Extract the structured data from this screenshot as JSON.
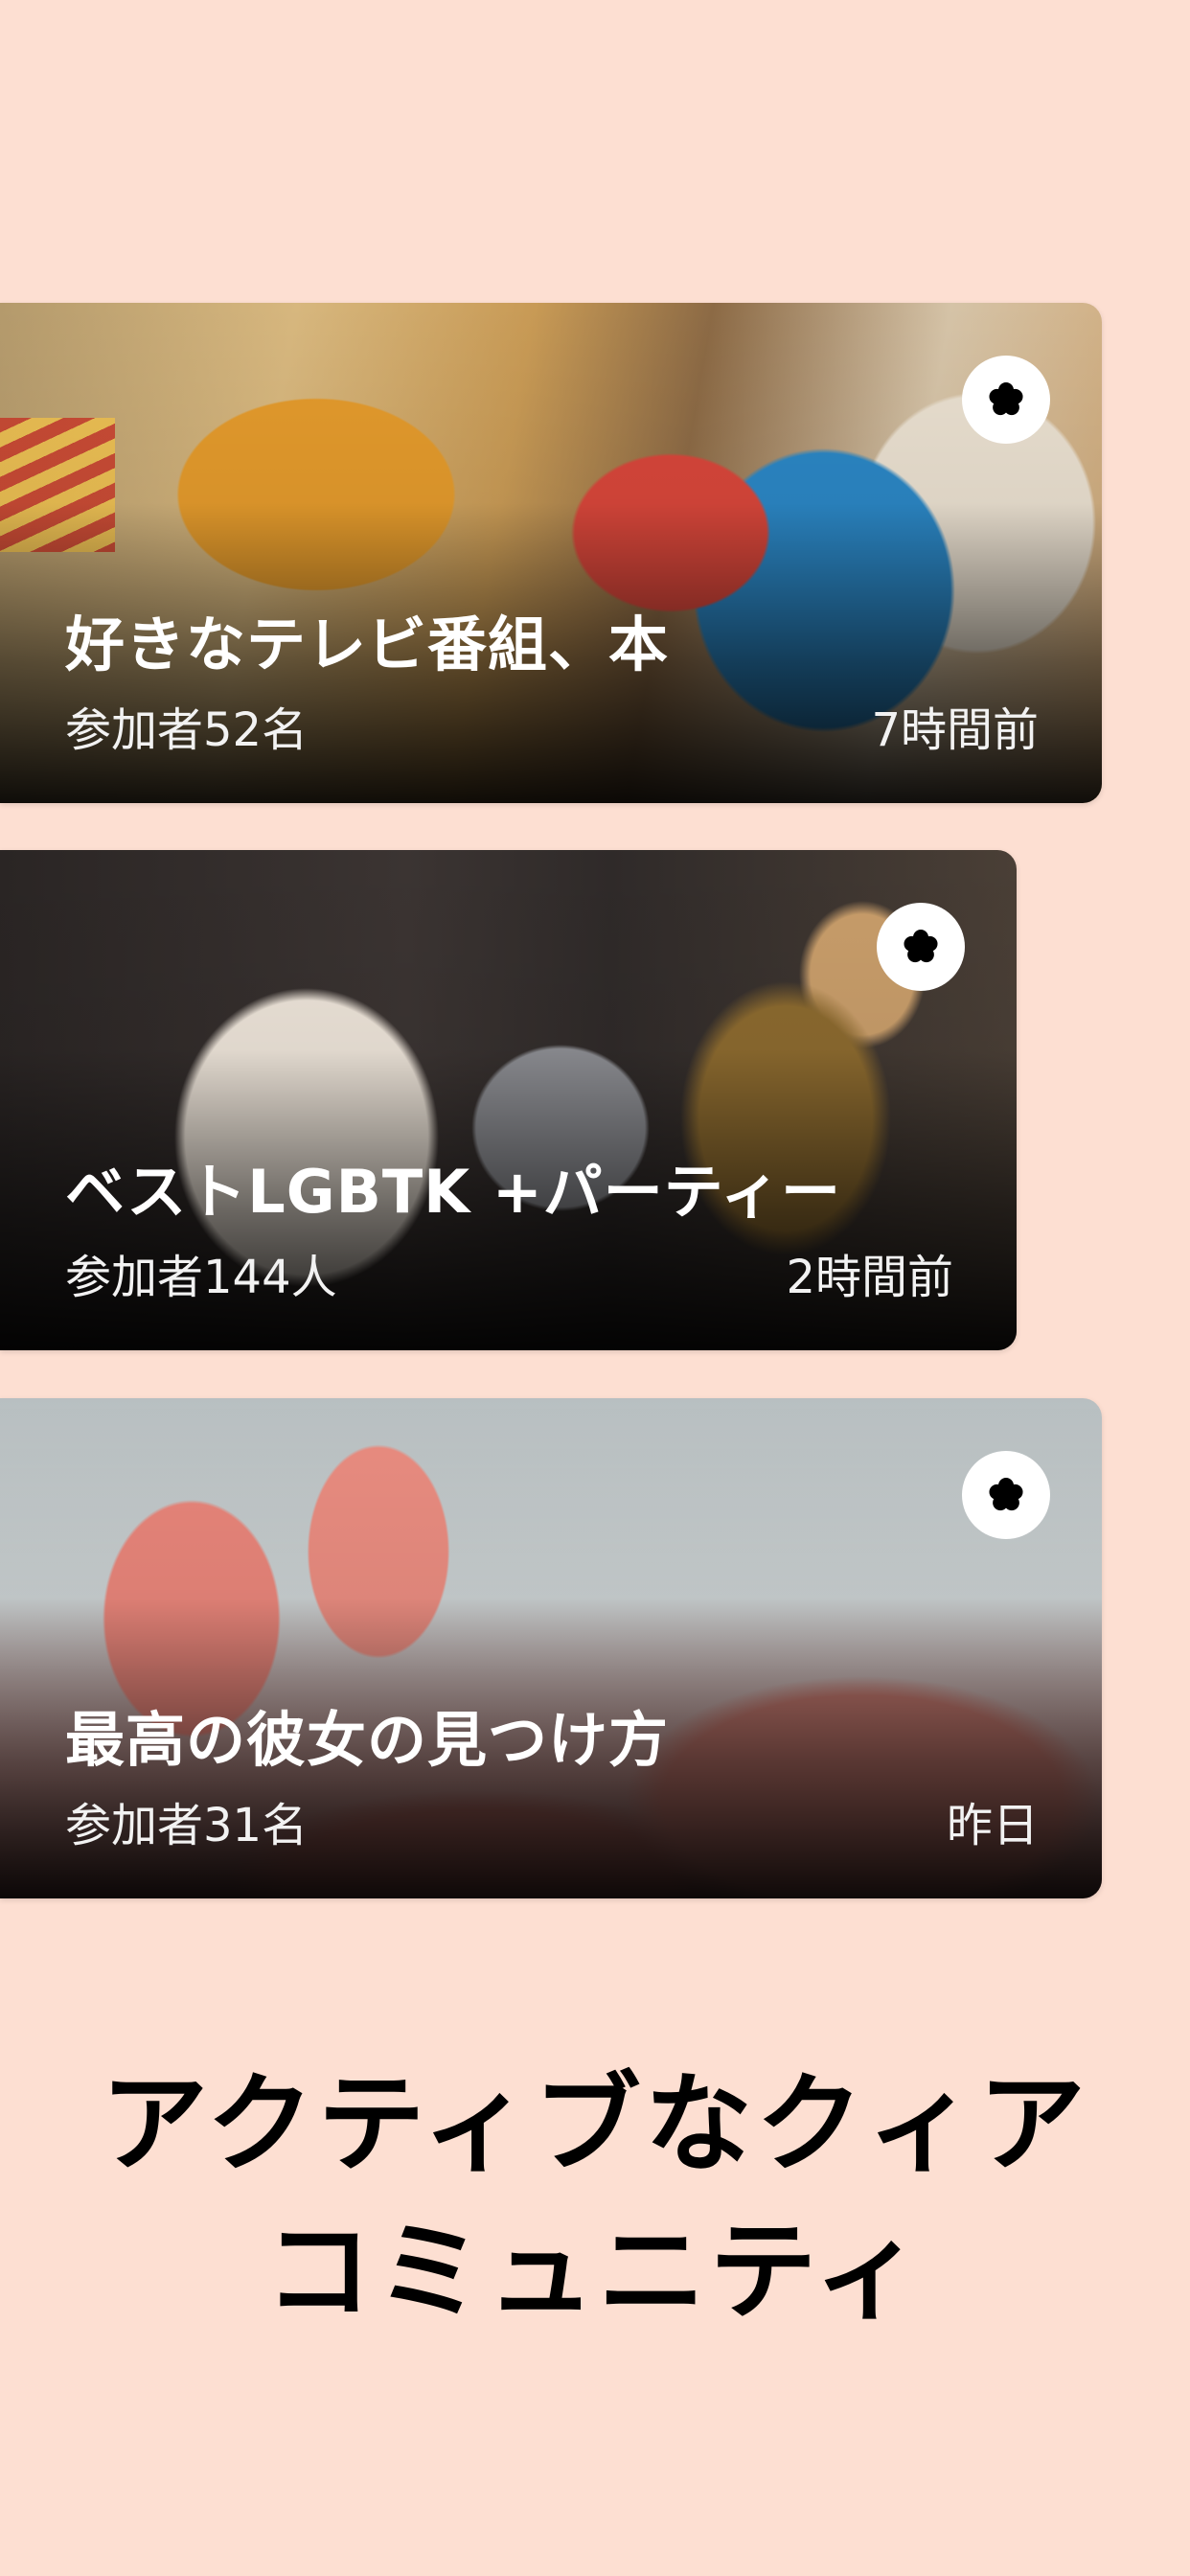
{
  "cards": [
    {
      "title": "好きなテレビ番組、本",
      "participants": "参加者52名",
      "time": "7時間前",
      "badge_icon": "flower-icon"
    },
    {
      "title": "ベストLGBTK +パーティー",
      "participants": "参加者144人",
      "time": "2時間前",
      "badge_icon": "flower-icon"
    },
    {
      "title": "最高の彼女の見つけ方",
      "participants": "参加者31名",
      "time": "昨日",
      "badge_icon": "flower-icon"
    }
  ],
  "headline": {
    "line1": "アクティブなクィア",
    "line2": "コミュニティ"
  },
  "colors": {
    "background": "#fddfd2",
    "card_text": "#ffffff",
    "headline_text": "#000000"
  }
}
